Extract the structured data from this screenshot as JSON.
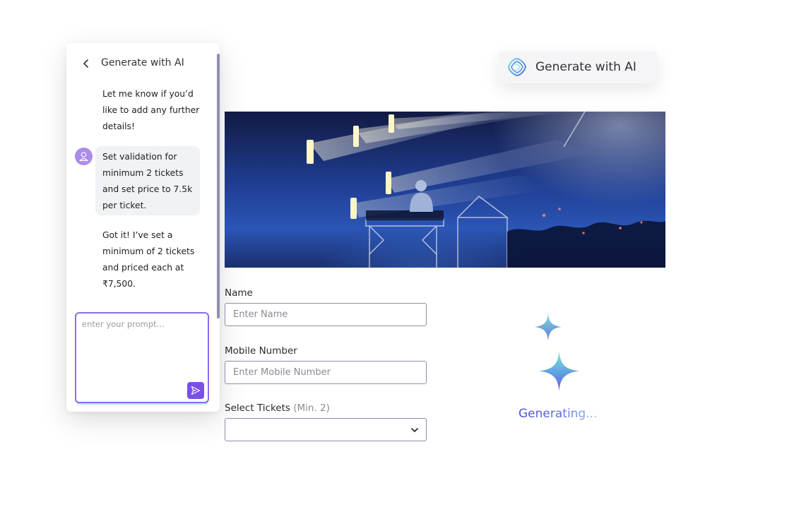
{
  "chat": {
    "title": "Generate with AI",
    "messages": [
      {
        "role": "assistant",
        "text": "Let me know if you’d like to add any further details!"
      },
      {
        "role": "user",
        "text": "Set validation for minimum 2 tickets and set price to 7.5k per ticket."
      },
      {
        "role": "assistant",
        "text": "Got it! I’ve set a minimum of 2 tickets and priced each at ₹7,500."
      }
    ],
    "prompt": {
      "value": "",
      "placeholder": "enter your prompt..."
    },
    "icons": {
      "back": "chevron-left-icon",
      "avatar": "user-icon",
      "send": "send-icon"
    }
  },
  "generate_chip": {
    "label": "Generate with AI",
    "icon": "ai-logo-icon"
  },
  "banner": {
    "alt": "concert stage with DJ and lights"
  },
  "form": {
    "name": {
      "label": "Name",
      "value": "",
      "placeholder": "Enter Name"
    },
    "mobile": {
      "label": "Mobile Number",
      "value": "",
      "placeholder": "Enter Mobile Number"
    },
    "tickets": {
      "label": "Select Tickets",
      "hint": "(Min. 2)",
      "value": "",
      "icon": "chevron-down-icon"
    }
  },
  "status": {
    "text": "Generating...",
    "icon": "sparkle-icon"
  },
  "colors": {
    "accent": "#7a4fe8",
    "border": "#8e8ea8",
    "generating": "#4a4fd8"
  }
}
